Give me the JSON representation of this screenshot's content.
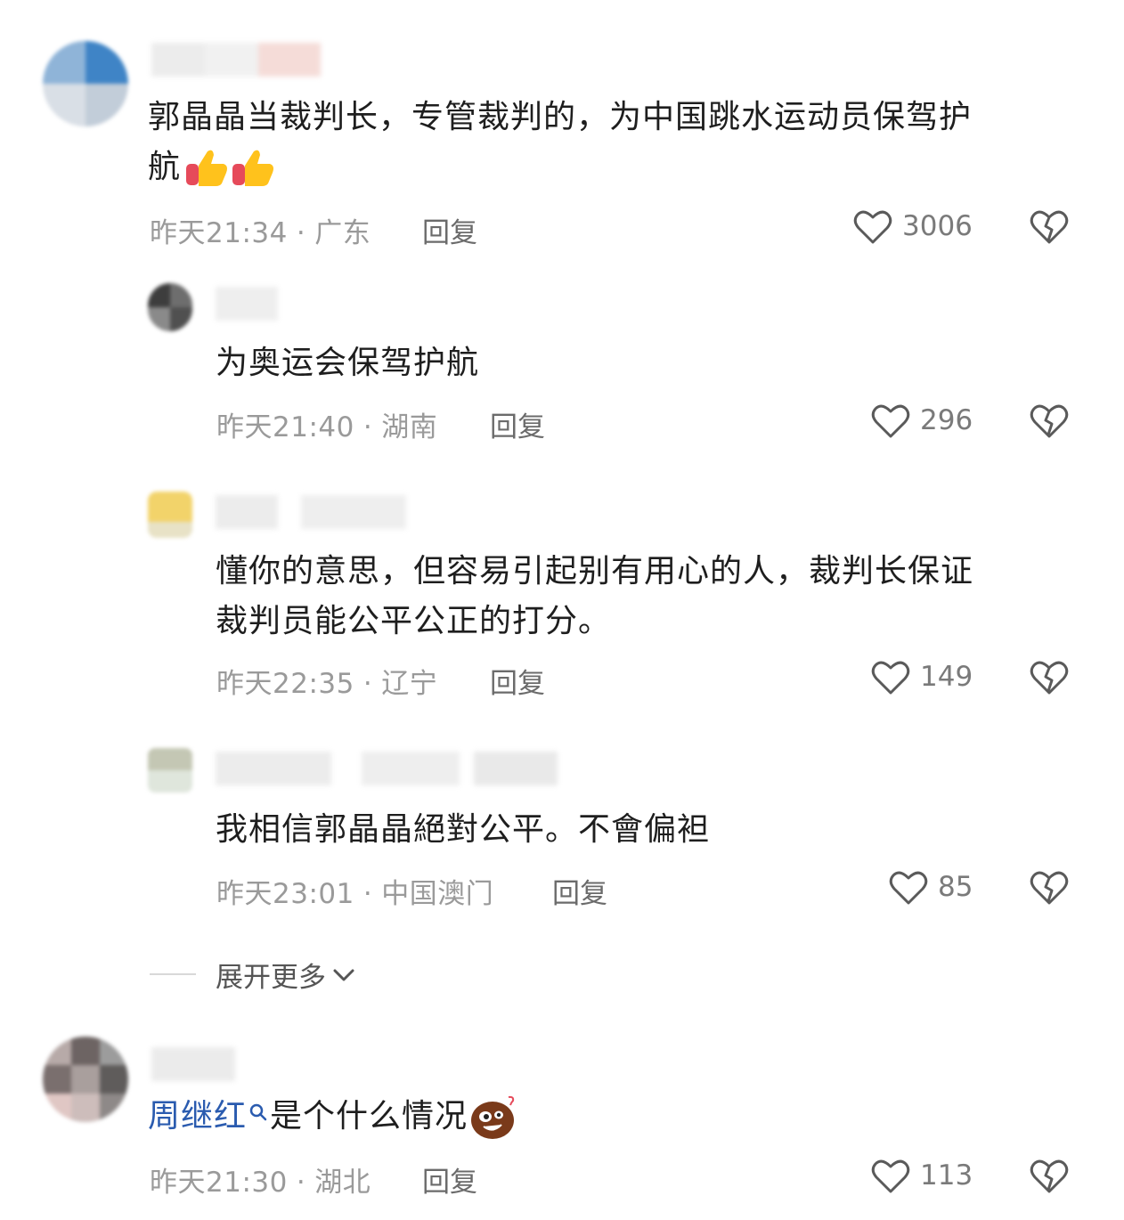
{
  "comments": [
    {
      "text_line1": "郭晶晶当裁判长，专管裁判的，为中国跳水运动员保驾护",
      "text_line2": "航",
      "time": "昨天21:34",
      "location": "广东",
      "sep": "·",
      "reply_label": "回复",
      "likes": "3006"
    },
    {
      "text": "为奥运会保驾护航",
      "time": "昨天21:40",
      "location": "湖南",
      "sep": "·",
      "reply_label": "回复",
      "likes": "296"
    },
    {
      "text_line1": "懂你的意思，但容易引起别有用心的人，裁判长保证",
      "text_line2": "裁判员能公平公正的打分。",
      "time": "昨天22:35",
      "location": "辽宁",
      "sep": "·",
      "reply_label": "回复",
      "likes": "149"
    },
    {
      "text": "我相信郭晶晶絕對公平。不會偏袒",
      "time": "昨天23:01",
      "location": "中国澳门",
      "sep": "·",
      "reply_label": "回复",
      "likes": "85"
    },
    {
      "link_text": "周继红",
      "text": "是个什么情况",
      "time": "昨天21:30",
      "location": "湖北",
      "sep": "·",
      "reply_label": "回复",
      "likes": "113"
    }
  ],
  "expand_label": "展开更多",
  "icons": {
    "like": "heart-outline-icon",
    "dislike": "broken-heart-icon",
    "thumbs": "thumbs-up-emoji-icon",
    "search": "search-icon",
    "emoji": "smiling-face-emoji-icon",
    "chevron": "chevron-down-icon"
  },
  "colors": {
    "text": "#1e1e1e",
    "meta": "#9a9a9a",
    "link": "#2a5baf",
    "icon": "#5a5a5a"
  }
}
